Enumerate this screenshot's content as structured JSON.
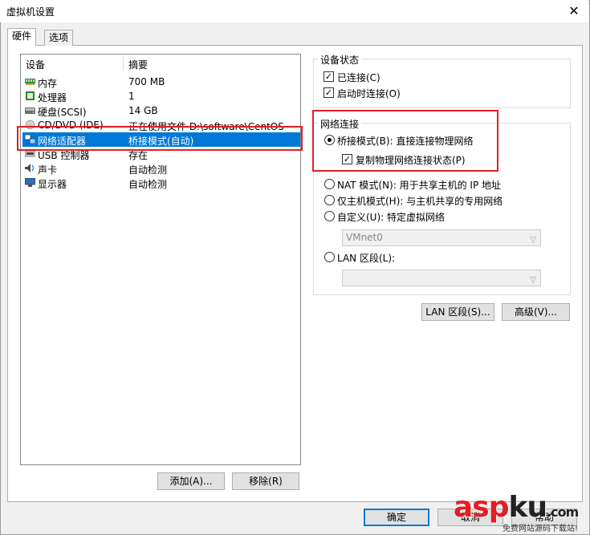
{
  "window": {
    "title": "虚拟机设置",
    "close_glyph": "✕"
  },
  "tabs": [
    {
      "label": "硬件"
    },
    {
      "label": "选项"
    }
  ],
  "device_list": {
    "headers": {
      "device": "设备",
      "summary": "摘要"
    },
    "rows": [
      {
        "name": "内存",
        "summary": "700 MB",
        "icon": "memory-icon"
      },
      {
        "name": "处理器",
        "summary": "1",
        "icon": "processor-icon"
      },
      {
        "name": "硬盘(SCSI)",
        "summary": "14 GB",
        "icon": "harddisk-icon"
      },
      {
        "name": "CD/DVD (IDE)",
        "summary": "正在使用文件 D:\\software\\CentOS-",
        "icon": "cdrom-icon"
      },
      {
        "name": "网络适配器",
        "summary": "桥接模式(自动)",
        "icon": "network-adapter-icon",
        "selected": true
      },
      {
        "name": "USB 控制器",
        "summary": "存在",
        "icon": "usb-icon"
      },
      {
        "name": "声卡",
        "summary": "自动检测",
        "icon": "sound-icon"
      },
      {
        "name": "显示器",
        "summary": "自动检测",
        "icon": "monitor-icon"
      }
    ]
  },
  "device_status": {
    "title": "设备状态",
    "connected": "已连接(C)",
    "connect_at_power_on": "启动时连接(O)"
  },
  "network_connection": {
    "title": "网络连接",
    "bridged": "桥接模式(B): 直接连接物理网络",
    "replicate": "复制物理网络连接状态(P)",
    "nat": "NAT 模式(N): 用于共享主机的 IP 地址",
    "host_only": "仅主机模式(H): 与主机共享的专用网络",
    "custom": "自定义(U): 特定虚拟网络",
    "custom_value": "VMnet0",
    "lan_segment": "LAN 区段(L):",
    "lan_value": ""
  },
  "buttons": {
    "lan_segments": "LAN 区段(S)...",
    "advanced": "高级(V)...",
    "add": "添加(A)...",
    "remove": "移除(R)",
    "ok": "确定",
    "cancel": "取消",
    "help": "帮助"
  },
  "watermark": {
    "asp": "asp",
    "ku": "ku",
    "com": ".com",
    "sub": "免费网站源码下载站!"
  },
  "colors": {
    "selection": "#0078d7",
    "highlight_box": "#e31e24"
  }
}
